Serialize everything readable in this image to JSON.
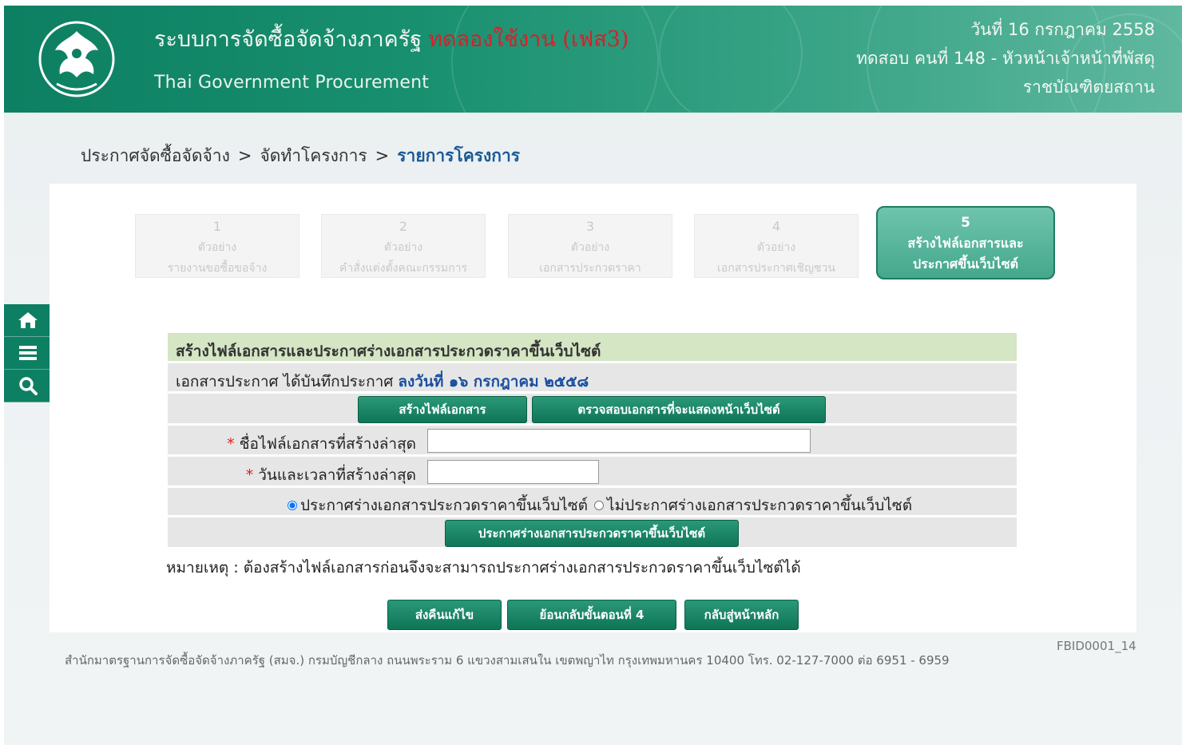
{
  "header": {
    "system_title": "ระบบการจัดซื้อจัดจ้างภาครัฐ",
    "trial_label": "ทดลองใช้งาน (เฟส3)",
    "subtitle": "Thai Government Procurement",
    "date": "วันที่ 16 กรกฎาคม 2558",
    "user": "ทดสอบ คนที่ 148 - หัวหน้าเจ้าหน้าที่พัสดุ",
    "org": "ราชบัณฑิตยสถาน"
  },
  "breadcrumb": {
    "item1": "ประกาศจัดซื้อจัดจ้าง",
    "item2": "จัดทำโครงการ",
    "item3": "รายการโครงการ",
    "separator": ">"
  },
  "side_tools": [
    "home-icon",
    "menu-icon",
    "search-icon"
  ],
  "steps": [
    {
      "num": "1",
      "line1": "ตัวอย่าง",
      "line2": "รายงานขอซื้อขอจ้าง"
    },
    {
      "num": "2",
      "line1": "ตัวอย่าง",
      "line2": "คำสั่งแต่งตั้งคณะกรรมการ"
    },
    {
      "num": "3",
      "line1": "ตัวอย่าง",
      "line2": "เอกสารประกวดราคา"
    },
    {
      "num": "4",
      "line1": "ตัวอย่าง",
      "line2": "เอกสารประกาศเชิญชวน"
    },
    {
      "num": "5",
      "line1": "สร้างไฟล์เอกสารและ",
      "line2": "ประกาศขึ้นเว็บไซต์"
    }
  ],
  "form": {
    "title": "สร้างไฟล์เอกสารและประกาศร่างเอกสารประกวดราคาขึ้นเว็บไซต์",
    "info_label": "เอกสารประกาศ ได้บันทึกประกาศ",
    "info_value": "ลงวันที่ ๑๖ กรกฎาคม ๒๕๕๘",
    "create_file_button": "สร้างไฟล์เอกสาร",
    "check_docs_button": "ตรวจสอบเอกสารที่จะแสดงหน้าเว็บไซต์",
    "required_mark": "*",
    "latest_file_label": "ชื่อไฟล์เอกสารที่สร้างล่าสุด",
    "latest_file_value": "",
    "latest_time_label": "วันและเวลาที่สร้างล่าสุด",
    "latest_time_value": "",
    "radio_publish": "ประกาศร่างเอกสารประกวดราคาขึ้นเว็บไซต์",
    "radio_no_publish": "ไม่ประกาศร่างเอกสารประกวดราคาขึ้นเว็บไซต์",
    "publish_button": "ประกาศร่างเอกสารประกวดราคาขึ้นเว็บไซต์",
    "note": "หมายเหตุ : ต้องสร้างไฟล์เอกสารก่อนจึงจะสามารถประกาศร่างเอกสารประกวดราคาขึ้นเว็บไซต์ได้"
  },
  "actions": {
    "return_edit": "ส่งคืนแก้ไข",
    "back_step4": "ย้อนกลับขั้นตอนที่ 4",
    "home": "กลับสู่หน้าหลัก"
  },
  "footer": {
    "address": "สำนักมาตรฐานการจัดซื้อจัดจ้างภาครัฐ (สมจ.) กรมบัญชีกลาง ถนนพระราม 6 แขวงสามเสนใน เขตพญาไท กรุงเทพมหานคร 10400 โทร. 02-127-7000 ต่อ 6951 - 6959",
    "page_id": "FBID0001_14"
  },
  "colors": {
    "header_green": "#0d7f62",
    "button_green": "#1a8a69",
    "trial_red": "#d8202a",
    "breadcrumb_current": "#1a5a96",
    "title_row": "#d4e6c4"
  }
}
